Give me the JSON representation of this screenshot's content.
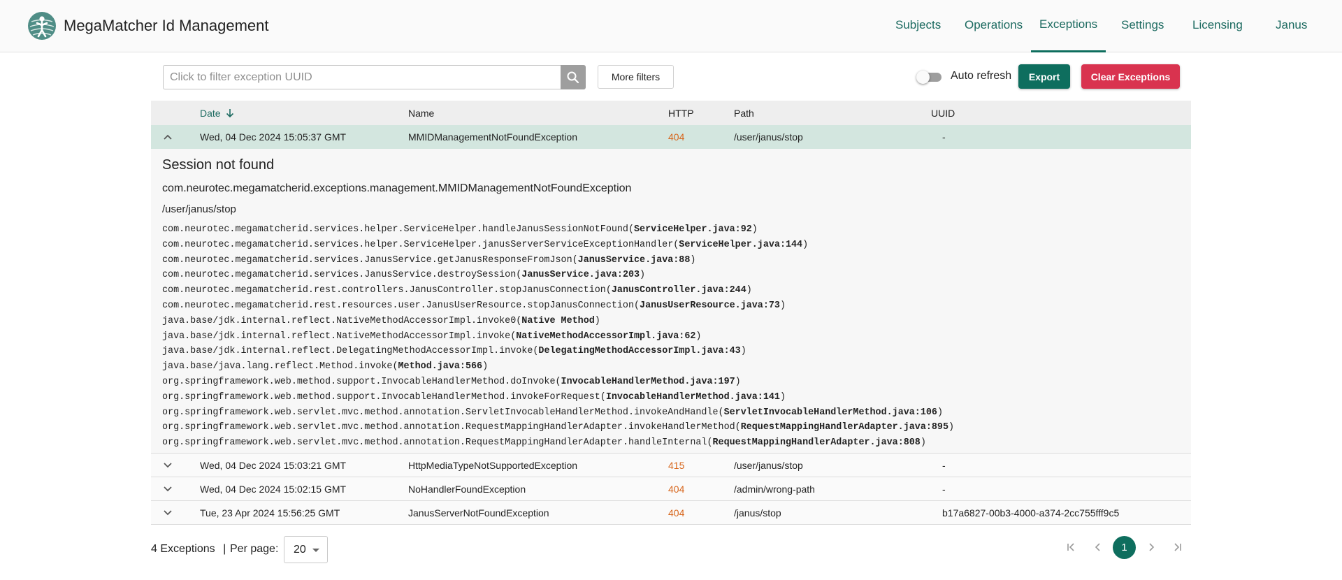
{
  "app": {
    "title": "MegaMatcher Id Management"
  },
  "nav": [
    {
      "label": "Subjects"
    },
    {
      "label": "Operations"
    },
    {
      "label": "Exceptions",
      "active": true
    },
    {
      "label": "Settings"
    },
    {
      "label": "Licensing"
    },
    {
      "label": "Janus"
    }
  ],
  "toolbar": {
    "search_placeholder": "Click to filter exception UUID",
    "search_value": "",
    "more_filters_label": "More filters",
    "auto_refresh_label": "Auto refresh",
    "auto_refresh_on": false,
    "export_label": "Export",
    "clear_label": "Clear Exceptions"
  },
  "table": {
    "headers": {
      "date": "Date",
      "name": "Name",
      "http": "HTTP",
      "path": "Path",
      "uuid": "UUID"
    },
    "rows": [
      {
        "date": "Wed, 04 Dec 2024 15:05:37 GMT",
        "name": "MMIDManagementNotFoundException",
        "http": "404",
        "path": "/user/janus/stop",
        "uuid": "-"
      },
      {
        "date": "Wed, 04 Dec 2024 15:03:21 GMT",
        "name": "HttpMediaTypeNotSupportedException",
        "http": "415",
        "path": "/user/janus/stop",
        "uuid": "-"
      },
      {
        "date": "Wed, 04 Dec 2024 15:02:15 GMT",
        "name": "NoHandlerFoundException",
        "http": "404",
        "path": "/admin/wrong-path",
        "uuid": "-"
      },
      {
        "date": "Tue, 23 Apr 2024 15:56:25 GMT",
        "name": "JanusServerNotFoundException",
        "http": "404",
        "path": "/janus/stop",
        "uuid": "b17a6827-00b3-4000-a374-2cc755fff9c5"
      }
    ],
    "details": {
      "title": "Session not found",
      "class_name": "com.neurotec.megamatcherid.exceptions.management.MMIDManagementNotFoundException",
      "path": "/user/janus/stop",
      "stack": [
        {
          "method": "com.neurotec.megamatcherid.services.helper.ServiceHelper.handleJanusSessionNotFound",
          "location": "ServiceHelper.java:92"
        },
        {
          "method": "com.neurotec.megamatcherid.services.helper.ServiceHelper.janusServerServiceExceptionHandler",
          "location": "ServiceHelper.java:144"
        },
        {
          "method": "com.neurotec.megamatcherid.services.JanusService.getJanusResponseFromJson",
          "location": "JanusService.java:88"
        },
        {
          "method": "com.neurotec.megamatcherid.services.JanusService.destroySession",
          "location": "JanusService.java:203"
        },
        {
          "method": "com.neurotec.megamatcherid.rest.controllers.JanusController.stopJanusConnection",
          "location": "JanusController.java:244"
        },
        {
          "method": "com.neurotec.megamatcherid.rest.resources.user.JanusUserResource.stopJanusConnection",
          "location": "JanusUserResource.java:73"
        },
        {
          "method": "java.base/jdk.internal.reflect.NativeMethodAccessorImpl.invoke0",
          "location": "Native Method"
        },
        {
          "method": "java.base/jdk.internal.reflect.NativeMethodAccessorImpl.invoke",
          "location": "NativeMethodAccessorImpl.java:62"
        },
        {
          "method": "java.base/jdk.internal.reflect.DelegatingMethodAccessorImpl.invoke",
          "location": "DelegatingMethodAccessorImpl.java:43"
        },
        {
          "method": "java.base/java.lang.reflect.Method.invoke",
          "location": "Method.java:566"
        },
        {
          "method": "org.springframework.web.method.support.InvocableHandlerMethod.doInvoke",
          "location": "InvocableHandlerMethod.java:197"
        },
        {
          "method": "org.springframework.web.method.support.InvocableHandlerMethod.invokeForRequest",
          "location": "InvocableHandlerMethod.java:141"
        },
        {
          "method": "org.springframework.web.servlet.mvc.method.annotation.ServletInvocableHandlerMethod.invokeAndHandle",
          "location": "ServletInvocableHandlerMethod.java:106"
        },
        {
          "method": "org.springframework.web.servlet.mvc.method.annotation.RequestMappingHandlerAdapter.invokeHandlerMethod",
          "location": "RequestMappingHandlerAdapter.java:895"
        },
        {
          "method": "org.springframework.web.servlet.mvc.method.annotation.RequestMappingHandlerAdapter.handleInternal",
          "location": "RequestMappingHandlerAdapter.java:808"
        }
      ]
    }
  },
  "footer": {
    "count_text": "4 Exceptions",
    "separator": "|",
    "per_page_label": "Per page:",
    "per_page_value": "20",
    "current_page": "1"
  },
  "colors": {
    "primary": "#0e6e5e",
    "danger": "#d9334f",
    "http_status": "#d7651b",
    "expanded_row": "#d3e6df"
  },
  "icons": {
    "logo": "megamatcher-logo",
    "search": "search-icon",
    "sort": "arrow-down-icon",
    "expand": "chevron-down-icon",
    "collapse": "chevron-up-icon",
    "first_page": "first-page-icon",
    "prev_page": "chevron-left-icon",
    "next_page": "chevron-right-icon",
    "last_page": "last-page-icon"
  }
}
